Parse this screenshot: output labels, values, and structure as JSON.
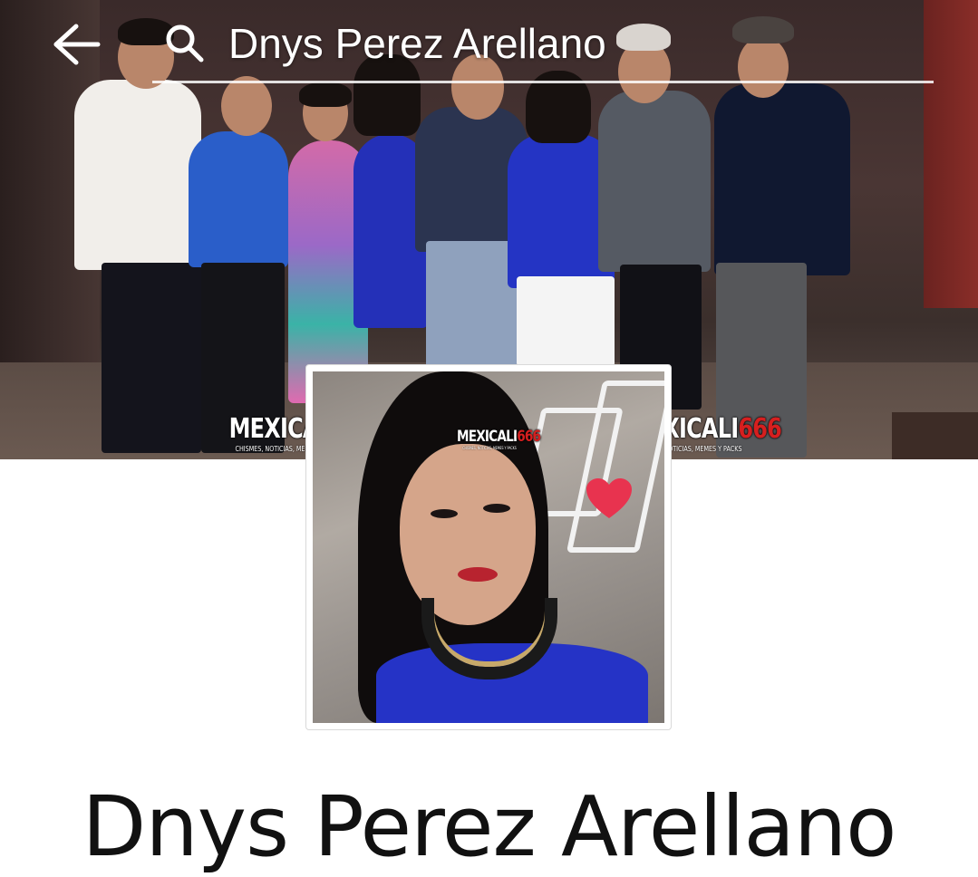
{
  "search": {
    "query": "Dnys Perez Arellano"
  },
  "icons": {
    "back": "arrow-left-icon",
    "search": "search-icon"
  },
  "watermark": {
    "brand": "MEXICALI",
    "brand_number": "666",
    "tagline": "CHISMES, NOTICIAS, MEMES Y PACKS"
  },
  "profile": {
    "name": "Dnys Perez Arellano"
  },
  "colors": {
    "watermark_accent": "#d61f1f",
    "search_text": "#ffffff",
    "name_text": "#111111"
  }
}
